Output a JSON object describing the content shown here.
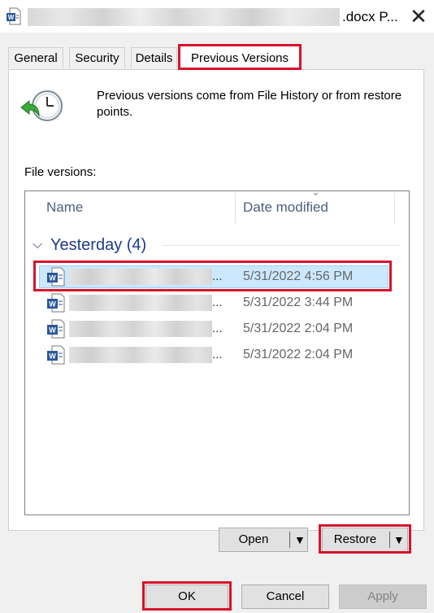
{
  "window": {
    "title_suffix": ".docx P...",
    "close_glyph": "✕",
    "icon": "word-document-icon"
  },
  "tabs": [
    {
      "label": "General",
      "active": false
    },
    {
      "label": "Security",
      "active": false
    },
    {
      "label": "Details",
      "active": false
    },
    {
      "label": "Previous Versions",
      "active": true
    }
  ],
  "info": {
    "icon": "file-history-clock-icon",
    "text": "Previous versions come from File History or from restore points."
  },
  "file_versions_label": "File versions:",
  "columns": {
    "name": "Name",
    "date_modified": "Date modified"
  },
  "group": {
    "label": "Yesterday (4)",
    "expanded": true
  },
  "rows": [
    {
      "name_visible": "...",
      "date_modified": "5/31/2022 4:56 PM",
      "selected": true
    },
    {
      "name_visible": "...",
      "date_modified": "5/31/2022 3:44 PM",
      "selected": false
    },
    {
      "name_visible": "...",
      "date_modified": "5/31/2022 2:04 PM",
      "selected": false
    },
    {
      "name_visible": "...",
      "date_modified": "5/31/2022 2:04 PM",
      "selected": false
    }
  ],
  "buttons": {
    "open": "Open",
    "restore": "Restore",
    "ok": "OK",
    "cancel": "Cancel",
    "apply": "Apply"
  },
  "colors": {
    "highlight_outline": "#d8132a",
    "selected_row": "#cce8ff",
    "group_header": "#1e3a8a"
  }
}
